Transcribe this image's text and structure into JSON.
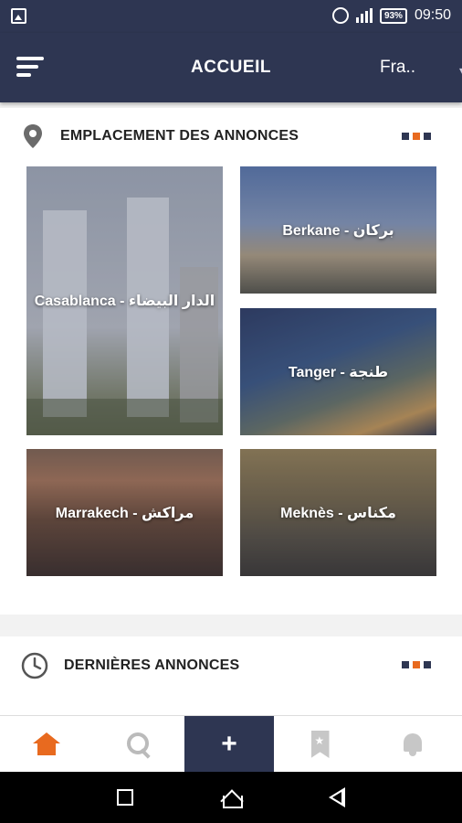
{
  "status_bar": {
    "battery": "93%",
    "time": "09:50"
  },
  "app_bar": {
    "title": "ACCUEIL",
    "language": "Fra.."
  },
  "locations_section": {
    "title": "EMPLACEMENT DES ANNONCES",
    "dot_colors": [
      "#2e3652",
      "#e86a1f",
      "#2e3652"
    ],
    "tiles": [
      {
        "label": "Casablanca - الدار البيضاء"
      },
      {
        "label": "Berkane - بركان"
      },
      {
        "label": "Tanger - طنجة"
      },
      {
        "label": "Marrakech - مراكش"
      },
      {
        "label": "Meknès - مكناس"
      }
    ]
  },
  "latest_section": {
    "title": "DERNIÈRES ANNONCES",
    "dot_colors": [
      "#2e3652",
      "#e86a1f",
      "#2e3652"
    ]
  },
  "bottom_nav": {
    "items": [
      "home-icon",
      "search-icon",
      "plus-icon",
      "bookmark-icon",
      "bell-icon"
    ],
    "active_color": "#e86a1f",
    "add_label": "+"
  },
  "colors": {
    "primary": "#2e3652",
    "accent": "#e86a1f"
  }
}
